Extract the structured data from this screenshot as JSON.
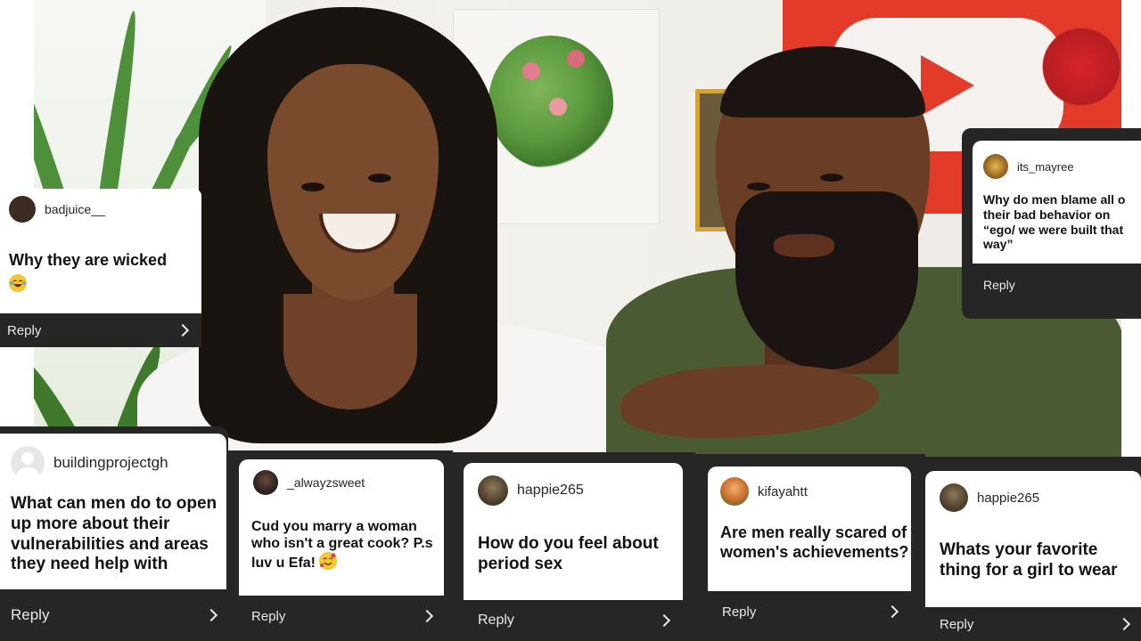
{
  "cards": [
    {
      "username": "badjuice__",
      "question": "Why they are wicked",
      "emoji_icon": "tears-of-joy-emoji-icon",
      "reply_label": "Reply",
      "avatar_color": "#3b2b22"
    },
    {
      "username": "its_mayree",
      "question": "Why do men blame all o their bad behavior on “ego/ we were built that way”",
      "reply_label": "Reply",
      "avatar_color": "#8a5a1a"
    },
    {
      "username": "buildingprojectgh",
      "question": "What can men do to open up more about their vulnerabilities and areas they need help with",
      "reply_label": "Reply",
      "avatar_color": "#d8d8d8"
    },
    {
      "username": "_alwayzsweet",
      "question": "Cud you marry a woman who isn't a great cook? P.s luv u Efa!",
      "emoji_icon": "smiling-face-with-hearts-emoji-icon",
      "reply_label": "Reply",
      "avatar_color": "#2a2320"
    },
    {
      "username": "happie265",
      "question": "How do you feel about period sex",
      "reply_label": "Reply",
      "avatar_color": "#4a3a2a"
    },
    {
      "username": "kifayahtt",
      "question": "Are men really scared of women's achievements?",
      "reply_label": "Reply",
      "avatar_color": "#c9692a"
    },
    {
      "username": "happie265",
      "question": "Whats your favorite thing for a girl to wear",
      "reply_label": "Reply",
      "avatar_color": "#4a3a2a"
    }
  ],
  "colors": {
    "card_bg": "#ffffff",
    "reply_bar": "#262626",
    "reply_text": "#e8e8e8",
    "youtube_red": "#e33b2a"
  }
}
